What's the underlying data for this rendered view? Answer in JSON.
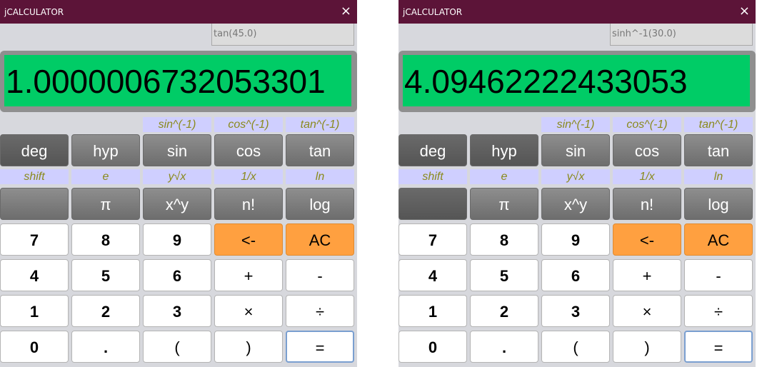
{
  "left": {
    "title": "jCALCULATOR",
    "close": "×",
    "expression": "tan(45.0)",
    "display": "1.0000006732053301"
  },
  "right": {
    "title": "jCALCULATOR",
    "close": "×",
    "expression": "sinh^-1(30.0)",
    "display": "4.09462222433053"
  },
  "labels_row1": [
    "sin^(-1)",
    "cos^(-1)",
    "tan^(-1)"
  ],
  "labels_row2": [
    "shift",
    "e",
    "y√x",
    "1/x",
    "ln"
  ],
  "keys": {
    "deg": "deg",
    "hyp": "hyp",
    "sin": "sin",
    "cos": "cos",
    "tan": "tan",
    "shift": "",
    "pi": "π",
    "pow": "x^y",
    "fact": "n!",
    "log": "log",
    "d7": "7",
    "d8": "8",
    "d9": "9",
    "back": "<-",
    "ac": "AC",
    "d4": "4",
    "d5": "5",
    "d6": "6",
    "plus": "+",
    "minus": "-",
    "d1": "1",
    "d2": "2",
    "d3": "3",
    "times": "×",
    "divide": "÷",
    "d0": "0",
    "dot": ".",
    "lparen": "(",
    "rparen": ")",
    "equals": "="
  },
  "colors": {
    "titlebar": "#5c1438",
    "display": "#00cc66",
    "label_bg": "#cfcfff",
    "label_text": "#8a8a1c",
    "orange": "#ffa040"
  }
}
